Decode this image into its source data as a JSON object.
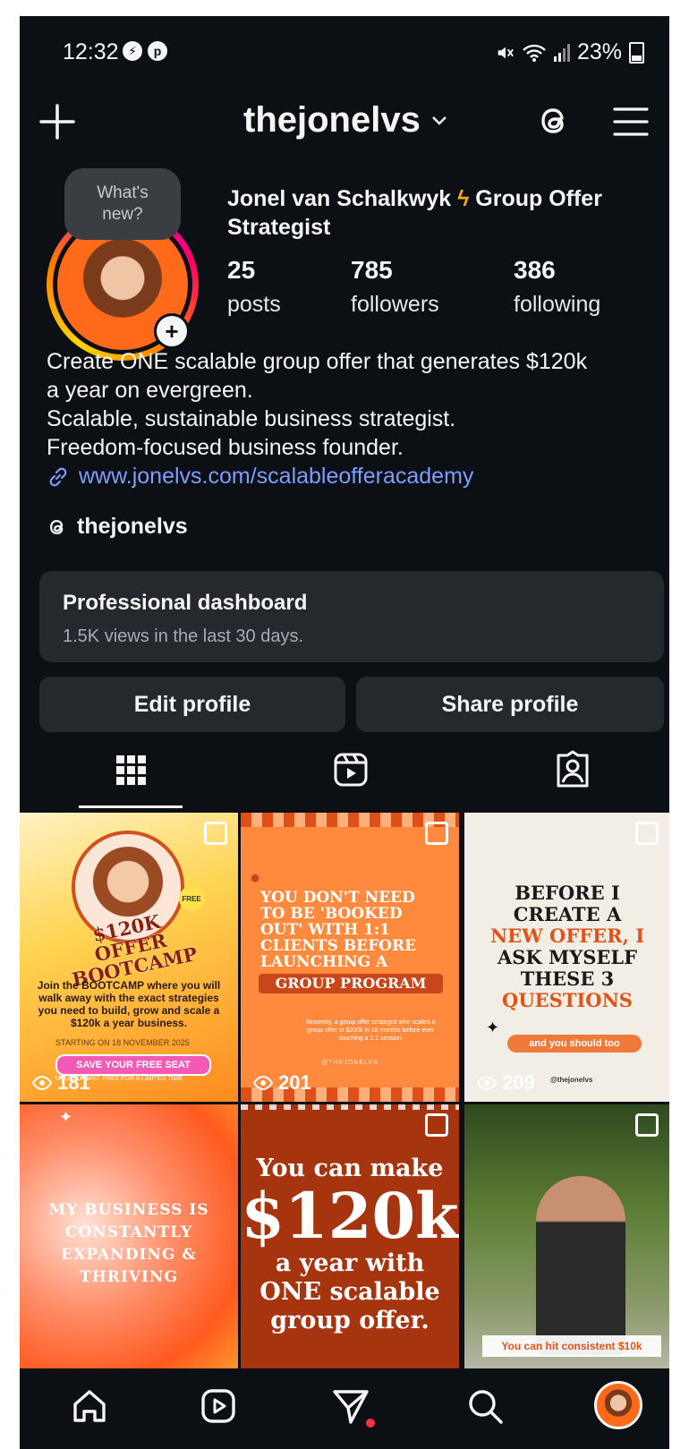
{
  "status_bar": {
    "time": "12:32",
    "battery": "23%"
  },
  "header": {
    "username": "thejonelvs"
  },
  "tooltip": {
    "line1": "What's",
    "line2": "new?"
  },
  "profile": {
    "name_part1": "Jonel van Schalkwyk",
    "name_part2": "Group Offer Strategist",
    "stats": [
      {
        "count": "25",
        "label": "posts"
      },
      {
        "count": "785",
        "label": "followers"
      },
      {
        "count": "386",
        "label": "following"
      }
    ],
    "bio_lines": [
      "Create ONE scalable group offer that generates $120k",
      "a year on evergreen.",
      "Scalable, sustainable business strategist.",
      "Freedom-focused business founder."
    ],
    "link": "www.jonelvs.com/scalableofferacademy",
    "threads_handle": "thejonelvs"
  },
  "dashboard": {
    "title": "Professional dashboard",
    "subtitle": "1.5K views in the last 30 days."
  },
  "buttons": {
    "edit": "Edit profile",
    "share": "Share profile"
  },
  "posts": [
    {
      "views": "181",
      "line1": "$120K OFFER",
      "line2": "BOOTCAMP",
      "body": "Join the BOOTCAMP where you will walk away with the exact strategies you need to build, grow and scale a $120k a year business.",
      "date": "STARTING ON 18 NOVEMBER 2025",
      "cta": "SAVE YOUR FREE SEAT",
      "small": "USUALLY $497, FREE FOR A LIMITED TIME",
      "badge": "FREE"
    },
    {
      "views": "201",
      "lines": [
        "YOU DON'T NEED",
        "TO BE 'BOOKED",
        "OUT' WITH 1:1",
        "CLIENTS BEFORE",
        "LAUNCHING A"
      ],
      "banner": "GROUP PROGRAM",
      "small": "Sincerely, a group offer strategist who scaled a group offer to $200k in 18 months before ever touching a 1:1 session",
      "handle": "@THEJONELVS"
    },
    {
      "views": "209",
      "lines": [
        "BEFORE I",
        "CREATE A"
      ],
      "red1": "NEW OFFER, I",
      "lines2": [
        "ASK MYSELF",
        "THESE 3"
      ],
      "red2": "QUESTIONS",
      "pill": "and you should too",
      "handle": "@thejonelvs"
    },
    {
      "lines": [
        "MY BUSINESS IS",
        "CONSTANTLY",
        "EXPANDING &",
        "THRIVING"
      ]
    },
    {
      "line1": "You can make",
      "big": "$120k",
      "line2": "a year with",
      "line3": "ONE scalable",
      "line4": "group offer."
    },
    {
      "caption": "You can hit consistent $10k"
    }
  ],
  "colors": {
    "background": "#0c1014",
    "card": "#25292e",
    "link": "#7f9cff",
    "accent_orange": "#ff7a21"
  }
}
